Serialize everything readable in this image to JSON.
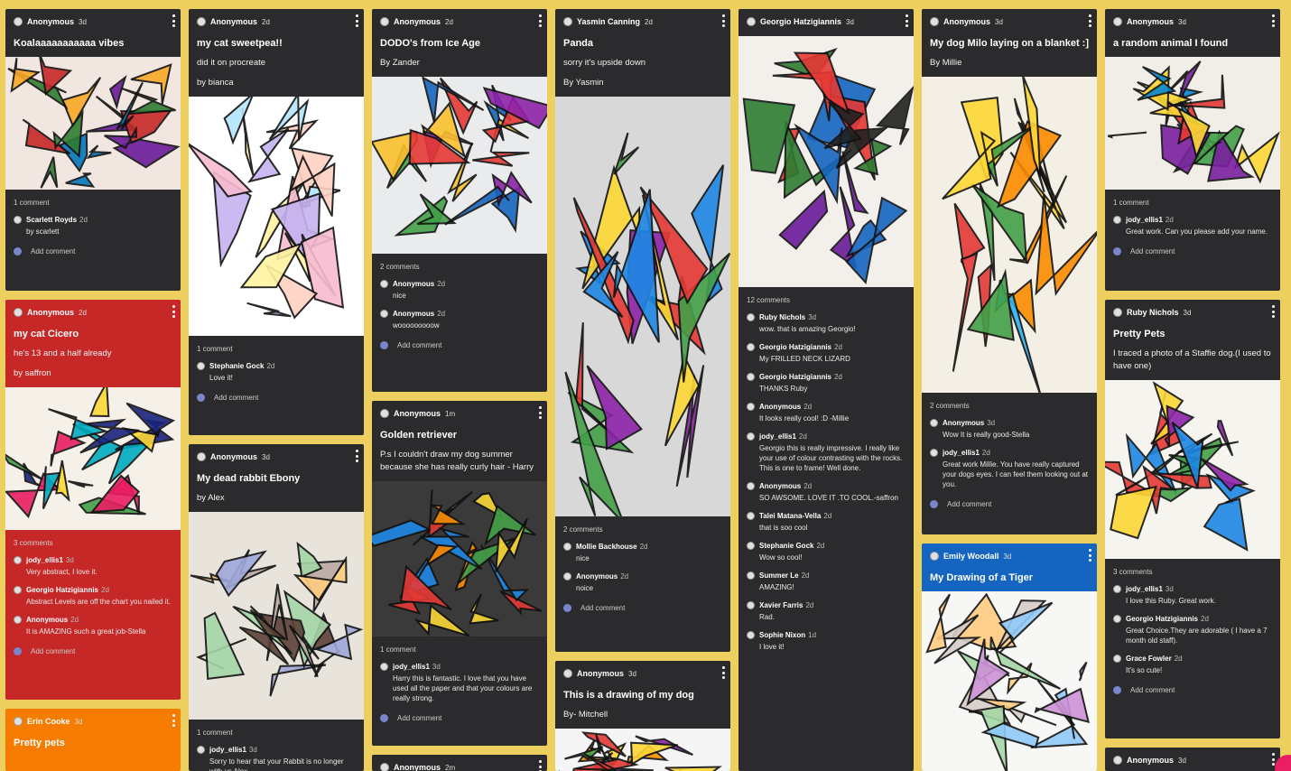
{
  "columns": [
    {
      "cards": [
        {
          "color": "dark",
          "author": "Anonymous",
          "age": "3d",
          "title": "Koalaaaaaaaaaaa vibes",
          "lines": [],
          "image": "koala-artwork",
          "comment_count": "1 comment",
          "comments": [
            {
              "name": "Scarlett Royds",
              "age": "2d",
              "text": "by scarlett"
            }
          ],
          "add_label": "Add comment"
        },
        {
          "color": "red",
          "author": "Anonymous",
          "age": "2d",
          "title": "my cat Cicero",
          "lines": [
            "he's 13 and a half already",
            "by saffron"
          ],
          "image": "abstract-cat-artwork",
          "comment_count": "3 comments",
          "comments": [
            {
              "name": "jody_ellis1",
              "age": "3d",
              "text": "Very abstract, I love it."
            },
            {
              "name": "Georgio Hatzigiannis",
              "age": "2d",
              "text": "Abstract Levels are off the chart you nailed it."
            },
            {
              "name": "Anonymous",
              "age": "2d",
              "text": "It is AMAZING such a great job-Stella"
            }
          ],
          "add_label": "Add comment"
        },
        {
          "color": "orange",
          "author": "Erin Cooke",
          "age": "3d",
          "title": "Pretty pets",
          "lines": [],
          "image": "",
          "comment_count": "",
          "comments": [],
          "add_label": ""
        }
      ]
    },
    {
      "cards": [
        {
          "color": "dark",
          "author": "Anonymous",
          "age": "2d",
          "title": "my cat sweetpea!!",
          "lines": [
            "did it on procreate",
            "by bianca"
          ],
          "image": "cat-face-artwork",
          "comment_count": "1 comment",
          "comments": [
            {
              "name": "Stephanie Gock",
              "age": "2d",
              "text": "Love it!"
            }
          ],
          "add_label": "Add comment"
        },
        {
          "color": "dark",
          "author": "Anonymous",
          "age": "3d",
          "title": "My dead rabbit Ebony",
          "lines": [
            "by Alex"
          ],
          "image": "rabbit-artwork",
          "comment_count": "1 comment",
          "comments": [
            {
              "name": "jody_ellis1",
              "age": "3d",
              "text": "Sorry to hear that your Rabbit is no longer with us Alex."
            }
          ],
          "add_label": ""
        }
      ]
    },
    {
      "cards": [
        {
          "color": "dark",
          "author": "Anonymous",
          "age": "2d",
          "title": "DODO's from Ice Age",
          "lines": [
            "By Zander"
          ],
          "image": "dodo-artwork",
          "comment_count": "2 comments",
          "comments": [
            {
              "name": "Anonymous",
              "age": "2d",
              "text": "nice"
            },
            {
              "name": "Anonymous",
              "age": "2d",
              "text": "wooooooooow"
            }
          ],
          "add_label": "Add comment"
        },
        {
          "color": "dark",
          "author": "Anonymous",
          "age": "1m",
          "title": "Golden retriever",
          "lines": [
            "P.s I couldn't  draw my dog summer because she has really curly hair - Harry"
          ],
          "image": "retriever-artwork",
          "comment_count": "1 comment",
          "comments": [
            {
              "name": "jody_ellis1",
              "age": "3d",
              "text": "Harry this is fantastic. I love that you have used all the paper and that your colours are really strong."
            }
          ],
          "add_label": "Add comment"
        },
        {
          "color": "dark",
          "author": "Anonymous",
          "age": "2m",
          "title": "",
          "lines": [],
          "image": "",
          "comment_count": "",
          "comments": [],
          "add_label": ""
        }
      ]
    },
    {
      "cards": [
        {
          "color": "dark",
          "author": "Yasmin Canning",
          "age": "2d",
          "title": "Panda",
          "lines": [
            "sorry it's upside down",
            "By Yasmin"
          ],
          "image": "panda-artwork",
          "comment_count": "2 comments",
          "comments": [
            {
              "name": "Mollie Backhouse",
              "age": "2d",
              "text": "nice"
            },
            {
              "name": "Anonymous",
              "age": "2d",
              "text": "noice"
            }
          ],
          "add_label": "Add comment"
        },
        {
          "color": "dark",
          "author": "Anonymous",
          "age": "3d",
          "title": "This is a drawing of my dog",
          "lines": [
            "By- Mitchell"
          ],
          "image": "dog-drawing-artwork",
          "comment_count": "",
          "comments": [],
          "add_label": ""
        }
      ]
    },
    {
      "cards": [
        {
          "color": "dark",
          "author": "Georgio Hatzigiannis",
          "age": "3d",
          "title": "",
          "lines": [],
          "image": "lizard-artwork",
          "comment_count": "12 comments",
          "comments": [
            {
              "name": "Ruby Nichols",
              "age": "3d",
              "text": "wow. that is amazing Georgio!"
            },
            {
              "name": "Georgio Hatzigiannis",
              "age": "2d",
              "text": "My FRILLED NECK LIZARD"
            },
            {
              "name": "Georgio Hatzigiannis",
              "age": "2d",
              "text": "THANKS Ruby"
            },
            {
              "name": "Anonymous",
              "age": "2d",
              "text": "It looks really cool! :D -Millie"
            },
            {
              "name": "jody_ellis1",
              "age": "2d",
              "text": "Georgio this is really impressive. I really like your use of colour contrasting with the rocks. This is one to frame! Well done."
            },
            {
              "name": "Anonymous",
              "age": "2d",
              "text": "SO AWSOME. LOVE IT .TO COOL.-saffron"
            },
            {
              "name": "Talei Matana-Vella",
              "age": "2d",
              "text": "that is soo cool"
            },
            {
              "name": "Stephanie Gock",
              "age": "2d",
              "text": "Wow so cool!"
            },
            {
              "name": "Summer Le",
              "age": "2d",
              "text": "AMAZING!"
            },
            {
              "name": "Xavier Farris",
              "age": "2d",
              "text": "Rad."
            },
            {
              "name": "Sophie Nixon",
              "age": "1d",
              "text": "I love it!"
            }
          ],
          "add_label": ""
        }
      ]
    },
    {
      "cards": [
        {
          "color": "dark",
          "author": "Anonymous",
          "age": "3d",
          "title": "My dog Milo laying on a blanket :]",
          "lines": [
            "By Millie"
          ],
          "image": "milo-artwork",
          "comment_count": "2 comments",
          "comments": [
            {
              "name": "Anonymous",
              "age": "3d",
              "text": "Wow It is really good-Stella"
            },
            {
              "name": "jody_ellis1",
              "age": "2d",
              "text": "Great work Millie. You have really captured your dogs eyes. I can feel them looking out at you."
            }
          ],
          "add_label": "Add comment"
        },
        {
          "color": "blue",
          "author": "Emily Woodall",
          "age": "3d",
          "title": "My Drawing of a Tiger",
          "lines": [],
          "image": "tiger-artwork",
          "comment_count": "",
          "comments": [],
          "add_label": ""
        }
      ]
    },
    {
      "cards": [
        {
          "color": "dark",
          "author": "Anonymous",
          "age": "3d",
          "title": "a random animal  I found",
          "lines": [],
          "image": "random-animal-artwork",
          "comment_count": "1 comment",
          "comments": [
            {
              "name": "jody_ellis1",
              "age": "2d",
              "text": "Great work. Can you please add your name."
            }
          ],
          "add_label": "Add comment"
        },
        {
          "color": "dark",
          "author": "Ruby Nichols",
          "age": "3d",
          "title": "Pretty Pets",
          "lines": [
            "I traced a photo of a Staffie dog.(I used to have one)"
          ],
          "image": "staffie-artwork",
          "comment_count": "3 comments",
          "comments": [
            {
              "name": "jody_ellis1",
              "age": "3d",
              "text": "I love this Ruby. Great work."
            },
            {
              "name": "Georgio Hatzigiannis",
              "age": "2d",
              "text": "Great Choice.They are adorable ( I have a 7 month old staff)."
            },
            {
              "name": "Grace Fowler",
              "age": "2d",
              "text": "It's so cute!"
            }
          ],
          "add_label": "Add comment"
        },
        {
          "color": "dark",
          "author": "Anonymous",
          "age": "3d",
          "title": "",
          "lines": [],
          "image": "",
          "comment_count": "",
          "comments": [],
          "add_label": ""
        }
      ]
    }
  ]
}
